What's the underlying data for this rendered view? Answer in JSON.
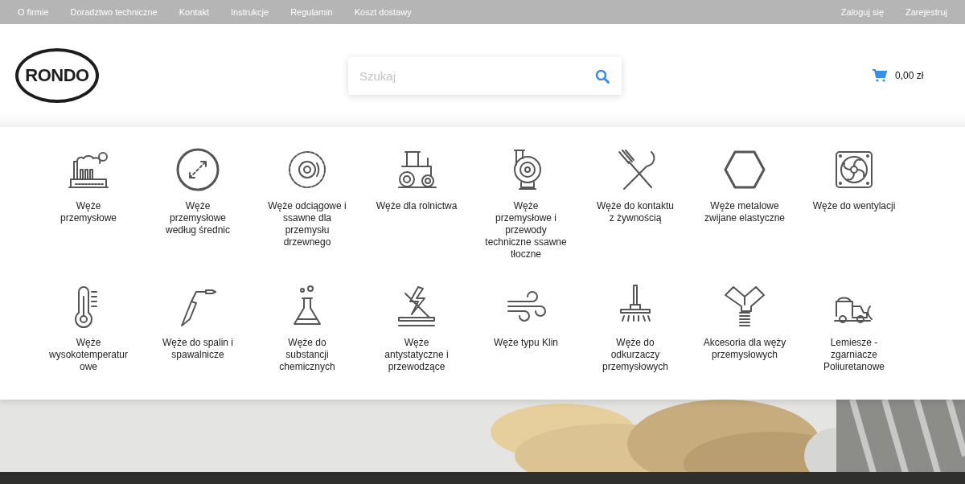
{
  "top_bar": {
    "links": [
      "O firmie",
      "Doradztwo techniczne",
      "Kontakt",
      "Instrukcje",
      "Regulamin",
      "Koszt dostawy"
    ],
    "account_links": [
      "Zaloguj się",
      "Zarejestruj"
    ]
  },
  "header": {
    "logo": "RONDO",
    "search": {
      "placeholder": "Szukaj"
    },
    "cart": {
      "total": "0,00 zł"
    }
  },
  "categories": [
    {
      "label": "Węże przemysłowe"
    },
    {
      "label": "Węże przemysłowe według średnic"
    },
    {
      "label": "Węże odciągowe i ssawne dla przemysłu drzewnego"
    },
    {
      "label": "Węże dla rolnictwa"
    },
    {
      "label": "Węże przemysłowe i przewody techniczne ssawne tłoczne"
    },
    {
      "label": "Węże do kontaktu z żywnością"
    },
    {
      "label": "Węże metalowe zwijane elastyczne"
    },
    {
      "label": "Węże do wentylacji"
    },
    {
      "label": "Węże wysokotemperaturowe"
    },
    {
      "label": "Węże do spalin i spawalnicze"
    },
    {
      "label": "Węże do substancji chemicznych"
    },
    {
      "label": "Węże antystatyczne i przewodzące"
    },
    {
      "label": "Węże typu Klin"
    },
    {
      "label": "Węże do odkurzaczy przemysłowych"
    },
    {
      "label": "Akcesoria dla węży przemysłowych"
    },
    {
      "label": "Lemiesze - zgarniacze Poliuretanowe"
    }
  ]
}
